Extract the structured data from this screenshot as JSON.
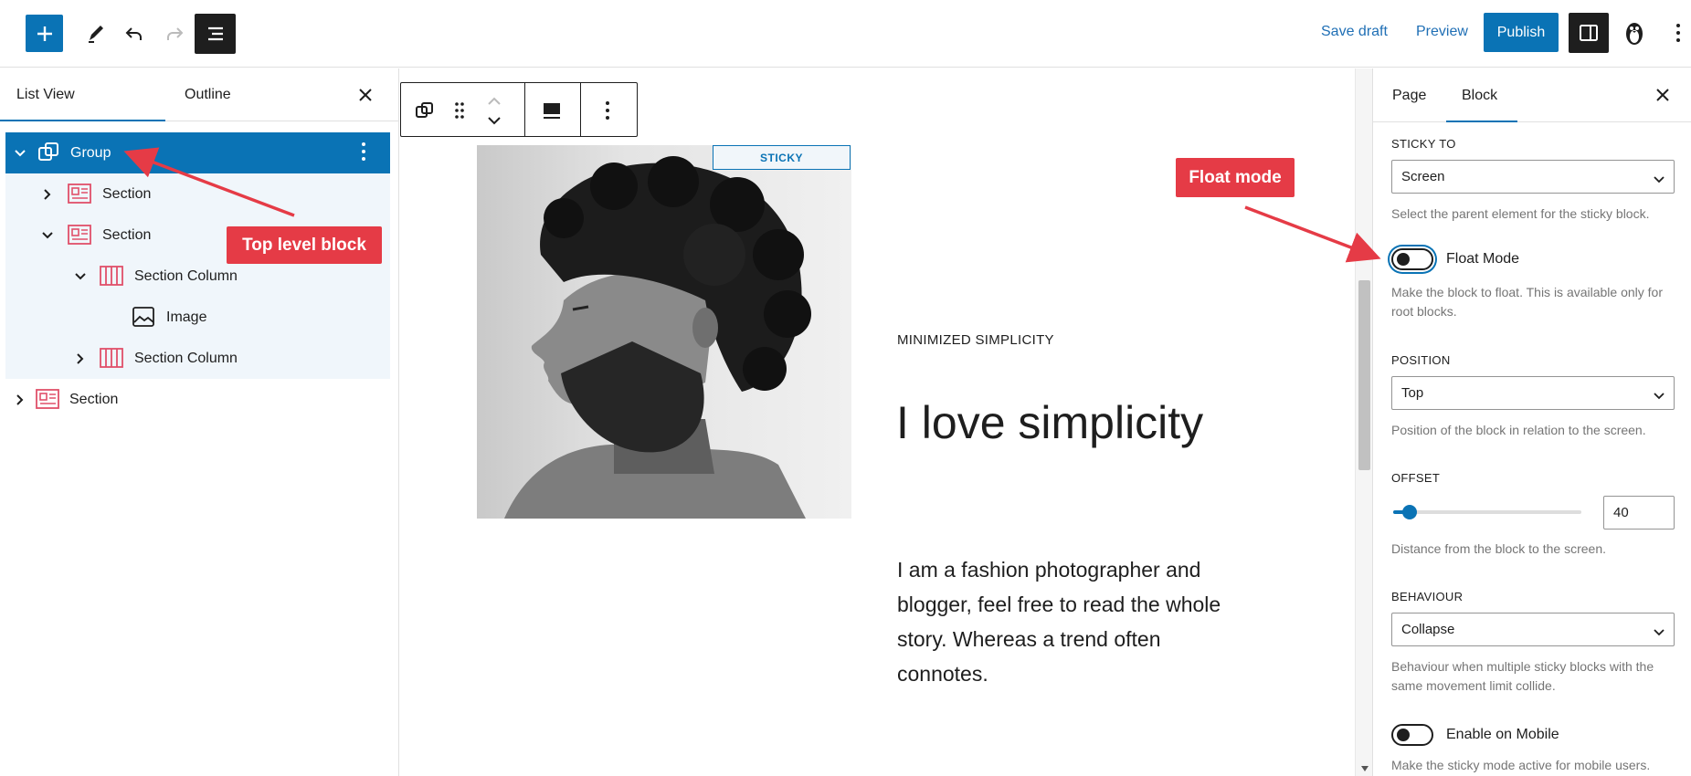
{
  "topbar": {
    "save_draft": "Save draft",
    "preview": "Preview",
    "publish": "Publish"
  },
  "left_panel": {
    "tabs": [
      "List View",
      "Outline"
    ],
    "tree": [
      {
        "label": "Group",
        "level": 0,
        "expanded": true,
        "selected": true,
        "icon": "group-icon"
      },
      {
        "label": "Section",
        "level": 1,
        "expanded": false,
        "icon": "section-icon"
      },
      {
        "label": "Section",
        "level": 1,
        "expanded": true,
        "icon": "section-icon"
      },
      {
        "label": "Section Column",
        "level": 2,
        "expanded": true,
        "icon": "section-column-icon"
      },
      {
        "label": "Image",
        "level": 3,
        "icon": "image-icon"
      },
      {
        "label": "Section Column",
        "level": 2,
        "expanded": false,
        "icon": "section-column-icon"
      },
      {
        "label": "Section",
        "level": 0,
        "expanded": false,
        "icon": "section-icon"
      }
    ]
  },
  "canvas": {
    "sticky_badge": "STICKY",
    "eyebrow": "MINIMIZED SIMPLICITY",
    "headline": "I love simplicity",
    "paragraph": "I am a fashion photographer and blogger, feel free to read the whole story. Whereas a trend often connotes."
  },
  "right_panel": {
    "tabs": [
      "Page",
      "Block"
    ],
    "sticky_to": {
      "title": "STICKY TO",
      "value": "Screen",
      "help": "Select the parent element for the sticky block."
    },
    "float_mode": {
      "label": "Float Mode",
      "enabled": false,
      "help": "Make the block to float. This is available only for root blocks."
    },
    "position": {
      "title": "POSITION",
      "value": "Top",
      "help": "Position of the block in relation to the screen."
    },
    "offset": {
      "title": "OFFSET",
      "value": "40",
      "level_fraction": 0.06,
      "help": "Distance from the block to the screen."
    },
    "behaviour": {
      "title": "BEHAVIOUR",
      "value": "Collapse",
      "help": "Behaviour when multiple sticky blocks with the same movement limit collide."
    },
    "mobile": {
      "label": "Enable on Mobile",
      "enabled": false,
      "help": "Make the sticky mode active for mobile users."
    }
  },
  "annotations": {
    "top_level_block": "Top level block",
    "float_mode": "Float mode"
  },
  "colors": {
    "accent": "#0a73b5",
    "callout": "#e53b46",
    "section_icon": "#e0506a"
  }
}
